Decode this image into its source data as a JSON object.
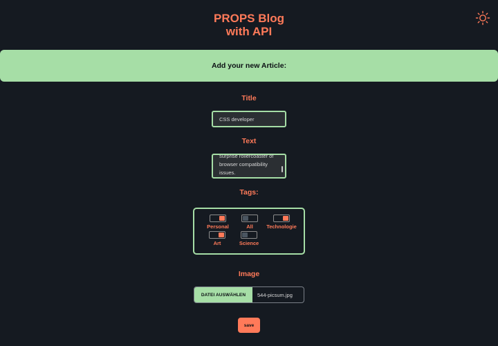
{
  "header": {
    "title_line1": "PROPS Blog",
    "title_line2": "with API",
    "theme_icon": "sun-icon"
  },
  "banner": {
    "text": "Add your new Article:"
  },
  "form": {
    "title_label": "Title",
    "title_value": "CSS developer",
    "text_label": "Text",
    "text_value": "surprise rollercoaster of browser compatibility issues.",
    "tags_label": "Tags:",
    "tags": [
      {
        "label": "Personal",
        "checked": true
      },
      {
        "label": "All",
        "checked": false
      },
      {
        "label": "Technologie",
        "checked": true
      },
      {
        "label": "Art",
        "checked": true
      },
      {
        "label": "Science",
        "checked": false
      }
    ],
    "image_label": "Image",
    "file_button_label": "DATEI AUSWÄHLEN",
    "file_name": "544-picsum.jpg",
    "save_label": "save"
  },
  "colors": {
    "background": "#151a21",
    "accent": "#ff7a59",
    "green": "#a6dea6"
  }
}
